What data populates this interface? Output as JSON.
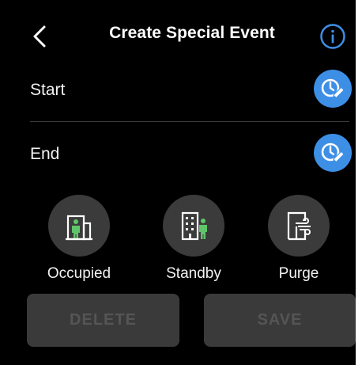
{
  "header": {
    "title": "Create Special Event",
    "back_icon": "chevron-left-icon",
    "info_icon": "info-icon"
  },
  "rows": {
    "start_label": "Start",
    "end_label": "End",
    "edit_time_icon": "clock-edit-icon"
  },
  "modes": [
    {
      "label": "Occupied",
      "icon": "building-occupied-icon"
    },
    {
      "label": "Standby",
      "icon": "building-standby-icon"
    },
    {
      "label": "Purge",
      "icon": "purge-icon"
    }
  ],
  "actions": {
    "delete_label": "DELETE",
    "save_label": "SAVE"
  },
  "colors": {
    "background": "#000000",
    "accent": "#3d8fe6",
    "occupant": "#5fc46a",
    "disabled_button": "#3a3a3a",
    "disabled_text": "#555555"
  }
}
